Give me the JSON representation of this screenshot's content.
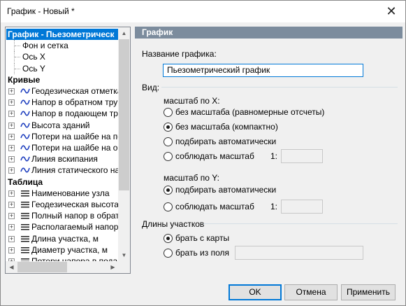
{
  "window": {
    "title": "График - Новый *"
  },
  "tree": {
    "rows": [
      {
        "type": "category",
        "label": "График - Пьезометрическ",
        "selected": true
      },
      {
        "type": "leaf",
        "label": "Фон и сетка"
      },
      {
        "type": "leaf",
        "label": "Ось X"
      },
      {
        "type": "leaf",
        "label": "Ось Y"
      },
      {
        "type": "category",
        "label": "Кривые"
      },
      {
        "type": "curve",
        "label": "Геодезическая отметка"
      },
      {
        "type": "curve",
        "label": "Напор в обратном трубо"
      },
      {
        "type": "curve",
        "label": "Напор в подающем труб"
      },
      {
        "type": "curve",
        "label": "Высота зданий"
      },
      {
        "type": "curve",
        "label": "Потери на шайбе на под"
      },
      {
        "type": "curve",
        "label": "Потери на шайбе на обр"
      },
      {
        "type": "curve",
        "label": "Линия вскипания"
      },
      {
        "type": "curve",
        "label": "Линия статического нап"
      },
      {
        "type": "category",
        "label": "Таблица"
      },
      {
        "type": "table",
        "label": "Наименование узла"
      },
      {
        "type": "table",
        "label": "Геодезическая высота,"
      },
      {
        "type": "table",
        "label": "Полный напор в обратно"
      },
      {
        "type": "table",
        "label": "Располагаемый напор, і"
      },
      {
        "type": "table",
        "label": "Длина участка, м"
      },
      {
        "type": "table",
        "label": "Диаметр участка, м"
      },
      {
        "type": "table",
        "label": "Потери напора в подаю"
      }
    ]
  },
  "panel": {
    "header": "График",
    "name_label": "Название графика:",
    "name_value": "Пьезометрический график",
    "view_label": "Вид:",
    "scale_x_label": "масштаб по X:",
    "scale_x_options": [
      {
        "label": "без масштаба (равномерные отсчеты)",
        "checked": false
      },
      {
        "label": "без масштаба (компактно)",
        "checked": true
      },
      {
        "label": "подбирать автоматически",
        "checked": false
      },
      {
        "label": "соблюдать масштаб",
        "checked": false
      }
    ],
    "scale_x_ratio_label": "1:",
    "scale_x_ratio_value": "",
    "scale_y_label": "масштаб по Y:",
    "scale_y_options": [
      {
        "label": "подбирать автоматически",
        "checked": true
      },
      {
        "label": "соблюдать масштаб",
        "checked": false
      }
    ],
    "scale_y_ratio_label": "1:",
    "scale_y_ratio_value": "",
    "lengths_label": "Длины участков",
    "lengths_options": [
      {
        "label": "брать с карты",
        "checked": true
      },
      {
        "label": "брать из поля",
        "checked": false
      }
    ],
    "lengths_field_value": ""
  },
  "buttons": {
    "ok": "OK",
    "cancel": "Отмена",
    "apply": "Применить"
  },
  "colors": {
    "header_bg": "#7c8c9d",
    "selection": "#0078d7",
    "curve_icon": "#1f3fbf"
  }
}
